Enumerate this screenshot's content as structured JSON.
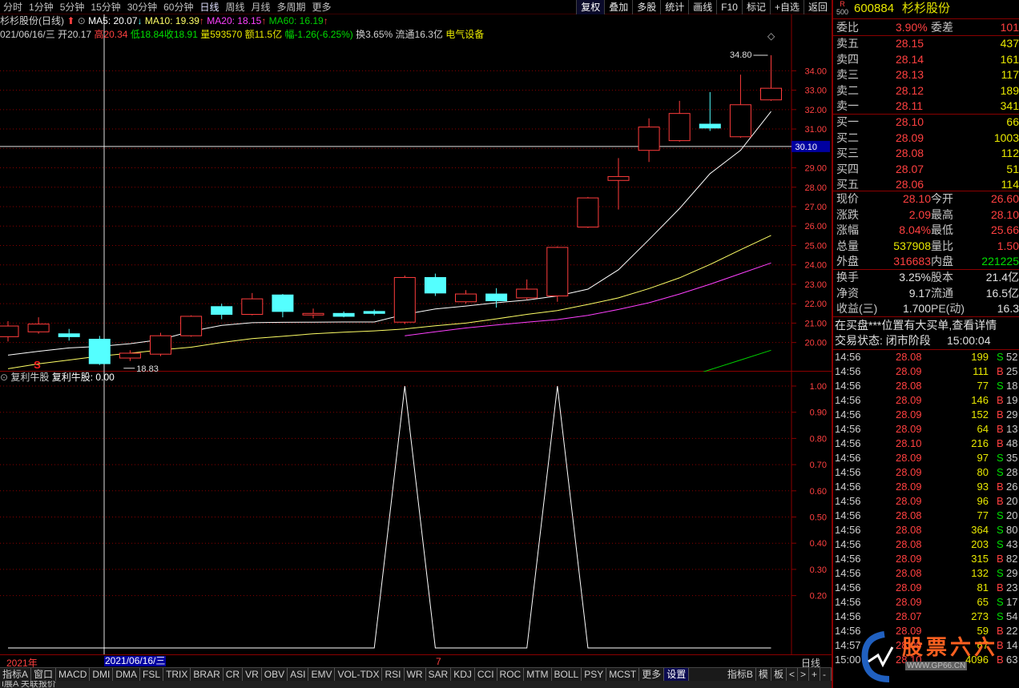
{
  "period_tabs": [
    "分时",
    "1分钟",
    "5分钟",
    "15分钟",
    "30分钟",
    "60分钟",
    "日线",
    "周线",
    "月线",
    "多周期",
    "更多"
  ],
  "active_period": "日线",
  "right_tools": [
    "复权",
    "叠加",
    "多股",
    "统计",
    "画线",
    "F10",
    "标记",
    "+自选",
    "返回"
  ],
  "stock_name": "杉杉股份(日线)",
  "ma": {
    "ma5": "MA5: 20.07",
    "ma10": "MA10: 19.39",
    "ma20": "MA20: 18.15",
    "ma60": "MA60: 16.19"
  },
  "info_line": {
    "date": "021/06/16/三",
    "open": "开20.17",
    "high": "高20.34",
    "low": "低18.84",
    "close": "收18.91",
    "volume": "量593570",
    "amount": "额11.5亿",
    "change": "幅-1.26(-6.25%)",
    "turnover": "换3.65%",
    "float": "流通16.3亿",
    "sector": "电气设备"
  },
  "price_axis": [
    "34.00",
    "33.00",
    "32.00",
    "31.00",
    "30.00",
    "29.00",
    "28.00",
    "27.00",
    "26.00",
    "25.00",
    "24.00",
    "23.00",
    "22.00",
    "21.00",
    "20.00"
  ],
  "crosshair_price": "30.10",
  "annotations": {
    "high_label": "34.80",
    "low_label": "18.83",
    "signal": "S"
  },
  "indicator": {
    "name": "复利牛股",
    "value_label": "复利牛股: 0.00",
    "axis": [
      "1.00",
      "0.90",
      "0.80",
      "0.70",
      "0.60",
      "0.50",
      "0.40",
      "0.30",
      "0.20"
    ]
  },
  "time_axis": {
    "year": "2021年",
    "cursor_date": "2021/06/16/三",
    "month": "7",
    "period": "日线"
  },
  "indicator_tabs": [
    "指标A",
    "窗口",
    "MACD",
    "DMI",
    "DMA",
    "FSL",
    "TRIX",
    "BRAR",
    "CR",
    "VR",
    "OBV",
    "ASI",
    "EMV",
    "VOL-TDX",
    "RSI",
    "WR",
    "SAR",
    "KDJ",
    "CCI",
    "ROC",
    "MTM",
    "BOLL",
    "PSY",
    "MCST",
    "更多",
    "设置"
  ],
  "indicator_tabs_right": [
    "指标B",
    "模",
    "板",
    "<",
    ">",
    "+",
    "-"
  ],
  "bottom_text": "ì展A  关联报价",
  "colors": {
    "up": "#ff3c3c",
    "down": "#54ffff",
    "ma5": "#ffffff",
    "ma10": "#ffff66",
    "ma20": "#ff40ff",
    "ma60": "#00d000",
    "grid": "#8a0000"
  },
  "chart_data": {
    "type": "candlestick",
    "candles": [
      {
        "o": 20.3,
        "c": 20.85,
        "h": 21.1,
        "l": 20.05
      },
      {
        "o": 20.55,
        "c": 20.95,
        "h": 21.3,
        "l": 20.45
      },
      {
        "o": 20.45,
        "c": 20.3,
        "h": 20.7,
        "l": 20.1
      },
      {
        "o": 20.17,
        "c": 18.91,
        "h": 20.34,
        "l": 18.84
      },
      {
        "o": 19.2,
        "c": 19.45,
        "h": 19.6,
        "l": 19.05
      },
      {
        "o": 19.4,
        "c": 20.35,
        "h": 20.5,
        "l": 19.3
      },
      {
        "o": 20.35,
        "c": 21.35,
        "h": 21.4,
        "l": 20.3
      },
      {
        "o": 21.85,
        "c": 21.45,
        "h": 22.0,
        "l": 21.2
      },
      {
        "o": 21.45,
        "c": 22.25,
        "h": 22.55,
        "l": 21.4
      },
      {
        "o": 22.45,
        "c": 21.6,
        "h": 22.5,
        "l": 21.3
      },
      {
        "o": 21.45,
        "c": 21.5,
        "h": 21.75,
        "l": 21.25
      },
      {
        "o": 21.5,
        "c": 21.35,
        "h": 21.6,
        "l": 21.3
      },
      {
        "o": 21.6,
        "c": 21.5,
        "h": 21.7,
        "l": 21.4
      },
      {
        "o": 21.05,
        "c": 23.35,
        "h": 23.45,
        "l": 20.95
      },
      {
        "o": 23.35,
        "c": 22.55,
        "h": 23.55,
        "l": 22.4
      },
      {
        "o": 22.1,
        "c": 22.5,
        "h": 22.7,
        "l": 22.0
      },
      {
        "o": 22.5,
        "c": 22.15,
        "h": 22.8,
        "l": 21.8
      },
      {
        "o": 22.3,
        "c": 22.75,
        "h": 23.25,
        "l": 22.2
      },
      {
        "o": 22.4,
        "c": 24.9,
        "h": 24.95,
        "l": 22.1
      },
      {
        "o": 25.95,
        "c": 27.45,
        "h": 27.5,
        "l": 25.9
      },
      {
        "o": 28.35,
        "c": 28.55,
        "h": 29.5,
        "l": 26.85
      },
      {
        "o": 29.9,
        "c": 31.1,
        "h": 31.55,
        "l": 29.3
      },
      {
        "o": 30.4,
        "c": 31.8,
        "h": 32.45,
        "l": 30.35
      },
      {
        "o": 31.25,
        "c": 31.05,
        "h": 32.9,
        "l": 30.9
      },
      {
        "o": 30.6,
        "c": 32.25,
        "h": 33.8,
        "l": 30.55
      },
      {
        "o": 32.5,
        "c": 33.1,
        "h": 34.8,
        "l": 32.45
      }
    ],
    "ma5": [
      19.35,
      19.55,
      19.72,
      19.8,
      19.94,
      20.15,
      20.58,
      20.88,
      21.02,
      21.04,
      21.05,
      21.06,
      21.06,
      21.45,
      21.73,
      21.88,
      22.05,
      22.19,
      22.4,
      22.75,
      23.75,
      25.3,
      26.9,
      28.7,
      29.9,
      31.9
    ],
    "ma10": [
      18.65,
      18.9,
      19.1,
      19.3,
      19.45,
      19.62,
      19.76,
      20.0,
      20.2,
      20.32,
      20.45,
      20.53,
      20.6,
      20.7,
      20.86,
      21.0,
      21.22,
      21.45,
      21.65,
      21.96,
      22.3,
      22.78,
      23.33,
      24.02,
      24.78,
      25.52
    ],
    "ma20": [
      null,
      null,
      null,
      null,
      null,
      null,
      null,
      null,
      null,
      null,
      null,
      null,
      null,
      20.35,
      20.55,
      20.75,
      20.9,
      21.05,
      21.18,
      21.4,
      21.7,
      22.05,
      22.5,
      23.0,
      23.55,
      24.1
    ],
    "ma60": [
      null,
      null,
      null,
      null,
      null,
      null,
      null,
      null,
      null,
      null,
      null,
      null,
      null,
      null,
      null,
      null,
      null,
      null,
      null,
      null,
      null,
      17.5,
      18.1,
      18.6,
      19.1,
      19.6
    ],
    "indicator_values": [
      0,
      0,
      0,
      0,
      0,
      0,
      0,
      0,
      0,
      0,
      0,
      0,
      0,
      1,
      0,
      0,
      0,
      0,
      1,
      0,
      0,
      0,
      0,
      0,
      0,
      0
    ],
    "ylim": [
      18.5,
      35.5
    ]
  },
  "quote": {
    "badge": "R",
    "badge_sub": "500",
    "code": "600884",
    "name": "杉杉股份",
    "weibi": {
      "label": "委比",
      "value": "3.90%",
      "diff_label": "委差",
      "diff": "101"
    },
    "sells": [
      {
        "label": "卖五",
        "price": "28.15",
        "vol": "437"
      },
      {
        "label": "卖四",
        "price": "28.14",
        "vol": "161"
      },
      {
        "label": "卖三",
        "price": "28.13",
        "vol": "117"
      },
      {
        "label": "卖二",
        "price": "28.12",
        "vol": "189"
      },
      {
        "label": "卖一",
        "price": "28.11",
        "vol": "341"
      }
    ],
    "buys": [
      {
        "label": "买一",
        "price": "28.10",
        "vol": "66"
      },
      {
        "label": "买二",
        "price": "28.09",
        "vol": "1003"
      },
      {
        "label": "买三",
        "price": "28.08",
        "vol": "112"
      },
      {
        "label": "买四",
        "price": "28.07",
        "vol": "51"
      },
      {
        "label": "买五",
        "price": "28.06",
        "vol": "114"
      }
    ],
    "stats": [
      {
        "l1": "现价",
        "v1": "28.10",
        "c1": "red",
        "l2": "今开",
        "v2": "26.60",
        "c2": "red"
      },
      {
        "l1": "涨跌",
        "v1": "2.09",
        "c1": "red",
        "l2": "最高",
        "v2": "28.10",
        "c2": "red"
      },
      {
        "l1": "涨幅",
        "v1": "8.04%",
        "c1": "red",
        "l2": "最低",
        "v2": "25.66",
        "c2": "red"
      },
      {
        "l1": "总量",
        "v1": "537908",
        "c1": "yel",
        "l2": "量比",
        "v2": "1.50",
        "c2": "red"
      },
      {
        "l1": "外盘",
        "v1": "316683",
        "c1": "red",
        "l2": "内盘",
        "v2": "221225",
        "c2": "green"
      }
    ],
    "fund": [
      {
        "l1": "换手",
        "v1": "3.25%",
        "l2": "股本",
        "v2": "21.4亿"
      },
      {
        "l1": "净资",
        "v1": "9.17",
        "l2": "流通",
        "v2": "16.5亿"
      },
      {
        "l1": "收益(三)",
        "v1": "1.700",
        "l2": "PE(动)",
        "v2": "16.3"
      }
    ],
    "notice": "在买盘***位置有大买单,查看详情",
    "status_label": "交易状态: 闭市阶段",
    "status_time": "15:00:04"
  },
  "ticks": [
    {
      "t": "14:56",
      "p": "28.08",
      "v": "199",
      "d": "S",
      "n": "52"
    },
    {
      "t": "14:56",
      "p": "28.09",
      "v": "111",
      "d": "B",
      "n": "25"
    },
    {
      "t": "14:56",
      "p": "28.08",
      "v": "77",
      "d": "S",
      "n": "18"
    },
    {
      "t": "14:56",
      "p": "28.09",
      "v": "146",
      "d": "B",
      "n": "19"
    },
    {
      "t": "14:56",
      "p": "28.09",
      "v": "152",
      "d": "B",
      "n": "29"
    },
    {
      "t": "14:56",
      "p": "28.09",
      "v": "64",
      "d": "B",
      "n": "13"
    },
    {
      "t": "14:56",
      "p": "28.10",
      "v": "216",
      "d": "B",
      "n": "48"
    },
    {
      "t": "14:56",
      "p": "28.09",
      "v": "97",
      "d": "S",
      "n": "35"
    },
    {
      "t": "14:56",
      "p": "28.09",
      "v": "80",
      "d": "S",
      "n": "28"
    },
    {
      "t": "14:56",
      "p": "28.09",
      "v": "93",
      "d": "B",
      "n": "26"
    },
    {
      "t": "14:56",
      "p": "28.09",
      "v": "96",
      "d": "B",
      "n": "20"
    },
    {
      "t": "14:56",
      "p": "28.08",
      "v": "77",
      "d": "S",
      "n": "20"
    },
    {
      "t": "14:56",
      "p": "28.08",
      "v": "364",
      "d": "S",
      "n": "80"
    },
    {
      "t": "14:56",
      "p": "28.08",
      "v": "203",
      "d": "S",
      "n": "43"
    },
    {
      "t": "14:56",
      "p": "28.09",
      "v": "315",
      "d": "B",
      "n": "82"
    },
    {
      "t": "14:56",
      "p": "28.08",
      "v": "132",
      "d": "S",
      "n": "29"
    },
    {
      "t": "14:56",
      "p": "28.09",
      "v": "81",
      "d": "B",
      "n": "23"
    },
    {
      "t": "14:56",
      "p": "28.09",
      "v": "65",
      "d": "S",
      "n": "17"
    },
    {
      "t": "14:56",
      "p": "28.07",
      "v": "273",
      "d": "S",
      "n": "54"
    },
    {
      "t": "14:56",
      "p": "28.09",
      "v": "59",
      "d": "B",
      "n": "22"
    },
    {
      "t": "14:57",
      "p": "28.09",
      "v": "67",
      "d": "B",
      "n": "14"
    },
    {
      "t": "15:00",
      "p": "28.10",
      "v": "4096",
      "d": "B",
      "n": "63"
    }
  ],
  "watermark": "股票六六",
  "watermark_url": "WWW.GP66.CN"
}
